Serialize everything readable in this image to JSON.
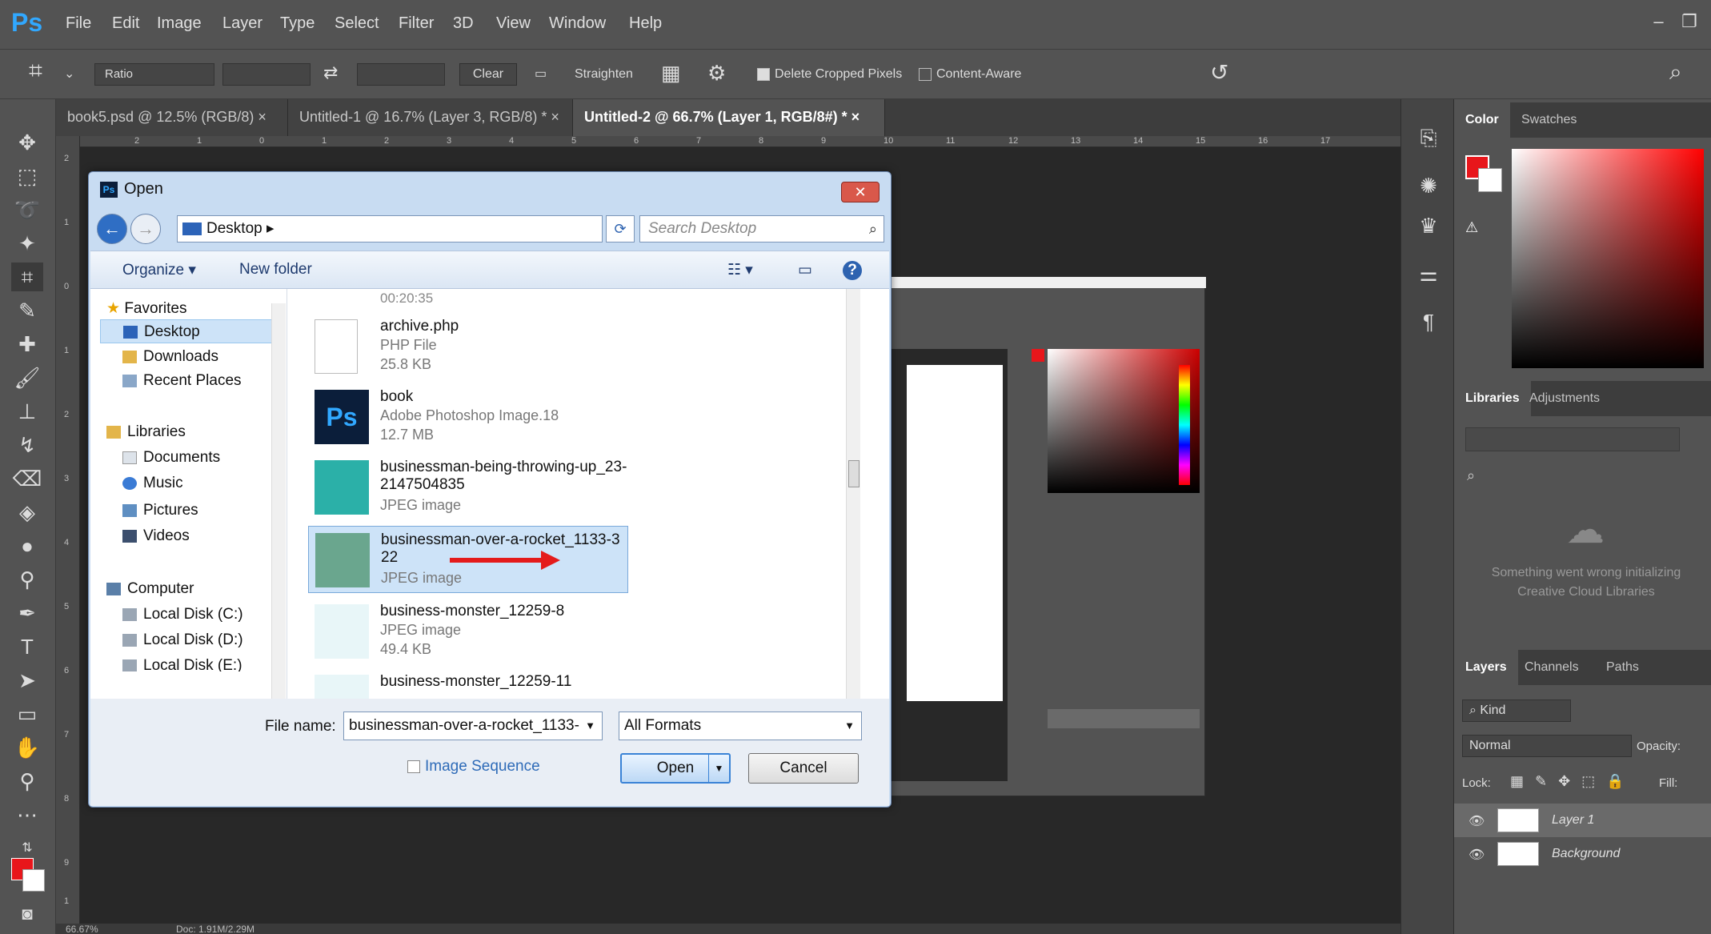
{
  "app": {
    "logo": "Ps"
  },
  "menu": [
    "File",
    "Edit",
    "Image",
    "Layer",
    "Type",
    "Select",
    "Filter",
    "3D",
    "View",
    "Window",
    "Help"
  ],
  "options": {
    "ratio": "Ratio",
    "clear": "Clear",
    "straighten": "Straighten",
    "delete_cropped": "Delete Cropped Pixels",
    "content_aware": "Content-Aware"
  },
  "tabs": [
    {
      "label": "book5.psd @ 12.5% (RGB/8) ×"
    },
    {
      "label": "Untitled-1 @ 16.7% (Layer 3, RGB/8) * ×"
    },
    {
      "label": "Untitled-2 @ 66.7% (Layer 1, RGB/8#) * ×"
    }
  ],
  "ruler_h": [
    "2",
    "1",
    "0",
    "1",
    "2",
    "3",
    "4",
    "5",
    "6",
    "7",
    "8",
    "9",
    "10",
    "11",
    "12",
    "13",
    "14",
    "15",
    "16",
    "17"
  ],
  "ruler_v": [
    "2",
    "1",
    "0",
    "1",
    "2",
    "3",
    "4",
    "5",
    "6",
    "7",
    "8",
    "9",
    "1"
  ],
  "status": {
    "zoom": "66.67%",
    "doc": "Doc: 1.91M/2.29M"
  },
  "panels": {
    "color_tabs": [
      "Color",
      "Swatches"
    ],
    "lib_tabs": [
      "Libraries",
      "Adjustments"
    ],
    "lib_error": "Something went wrong initializing Creative Cloud Libraries",
    "layer_tabs": [
      "Layers",
      "Channels",
      "Paths"
    ],
    "kind": "Kind",
    "blend": "Normal",
    "opacity_label": "Opacity:",
    "lock_label": "Lock:",
    "fill_label": "Fill:",
    "layers": [
      {
        "name": "Layer 1"
      },
      {
        "name": "Background"
      }
    ],
    "fg_color": "#e8161b"
  },
  "dialog": {
    "title": "Open",
    "address": "Desktop",
    "search_placeholder": "Search Desktop",
    "organize": "Organize ▾",
    "new_folder": "New folder",
    "nav": {
      "favorites": "Favorites",
      "fav_items": [
        "Desktop",
        "Downloads",
        "Recent Places"
      ],
      "libraries": "Libraries",
      "lib_items": [
        "Documents",
        "Music",
        "Pictures",
        "Videos"
      ],
      "computer": "Computer",
      "comp_items": [
        "Local Disk (C:)",
        "Local Disk (D:)",
        "Local Disk (E:)"
      ]
    },
    "top_time": "00:20:35",
    "files": [
      {
        "name": "archive.php",
        "type": "PHP File",
        "size": "25.8 KB"
      },
      {
        "name": "book",
        "type": "Adobe Photoshop Image.18",
        "size": "12.7 MB"
      },
      {
        "name": "businessman-being-throwing-up_23-2147504835",
        "type": "JPEG image",
        "size": ""
      },
      {
        "name": "businessman-over-a-rocket_1133-322",
        "type": "JPEG image",
        "size": ""
      },
      {
        "name": "business-monster_12259-8",
        "type": "JPEG image",
        "size": "49.4 KB"
      },
      {
        "name": "business-monster_12259-11",
        "type": "",
        "size": ""
      }
    ],
    "file_name_label": "File name:",
    "file_name_value": "businessman-over-a-rocket_1133-",
    "file_type": "All Formats",
    "image_sequence": "Image Sequence",
    "open_label": "Open",
    "cancel_label": "Cancel"
  }
}
